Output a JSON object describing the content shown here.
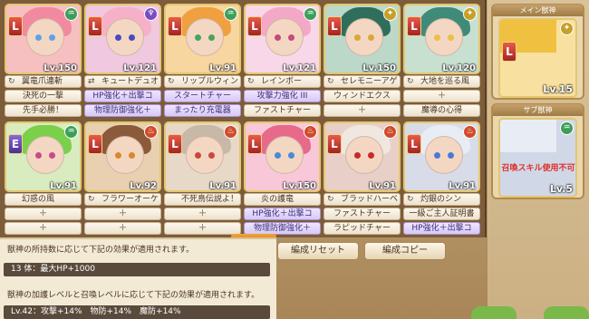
{
  "cards": [
    {
      "rank": "L",
      "elem": "♒",
      "elem_color": "#3d9e5a",
      "level": "Lv.150",
      "name": "翼竜爪連斬",
      "name_icon": "↻",
      "skill1": "決死の一撃",
      "skill1_type": "normal",
      "skill2": "先手必勝！",
      "skill2_type": "normal",
      "palette": {
        "bg": "#f6c0c0",
        "hair": "#f18aa0",
        "eye": "#5ea2e6"
      }
    },
    {
      "rank": "L",
      "elem": "♆",
      "elem_color": "#7a4cc4",
      "level": "Lv.121",
      "name": "キュートデュオ",
      "name_icon": "⇄",
      "skill1": "HP強化＋出撃コ",
      "skill1_type": "purple",
      "skill2": "物理防御強化＋",
      "skill2_type": "purple",
      "palette": {
        "bg": "#f0c8e0",
        "hair": "#f6b0c8",
        "eye": "#4a4abf"
      }
    },
    {
      "rank": "L",
      "elem": "♒",
      "elem_color": "#3d9e5a",
      "level": "Lv.91",
      "name": "リップルウィンド",
      "name_icon": "↻",
      "skill1": "スタートチャー",
      "skill1_type": "purple",
      "skill2": "まったり充電器",
      "skill2_type": "purple",
      "palette": {
        "bg": "#f7d6a0",
        "hair": "#f0a040",
        "eye": "#4aa35a"
      }
    },
    {
      "rank": "L",
      "elem": "♒",
      "elem_color": "#3d9e5a",
      "level": "Lv.121",
      "name": "レインボー",
      "name_icon": "↻",
      "skill1": "攻撃力強化 III",
      "skill1_type": "purple",
      "skill2": "ファストチャー",
      "skill2_type": "normal",
      "palette": {
        "bg": "#f8d8e8",
        "hair": "#f4a8c8",
        "eye": "#c64a7a"
      }
    },
    {
      "rank": "L",
      "elem": "✦",
      "elem_color": "#c7a02a",
      "level": "Lv.150",
      "name": "セレモニーアゲ",
      "name_icon": "↻",
      "skill1": "ウィンドエクス",
      "skill1_type": "normal",
      "skill2": "＋",
      "skill2_type": "plus",
      "palette": {
        "bg": "#bcd8c8",
        "hair": "#2f6e5a",
        "eye": "#d8a83a"
      }
    },
    {
      "rank": "L",
      "elem": "✦",
      "elem_color": "#c7a02a",
      "level": "Lv.120",
      "name": "大地を巡る風",
      "name_icon": "↻",
      "skill1": "＋",
      "skill1_type": "plus",
      "skill2": "魔導の心得",
      "skill2_type": "normal",
      "palette": {
        "bg": "#c8e0d0",
        "hair": "#3f8a78",
        "eye": "#e8c048"
      }
    },
    {
      "rank": "E",
      "elem": "♒",
      "elem_color": "#3d9e5a",
      "level": "Lv.91",
      "name": "幻惑の風",
      "name_icon": "",
      "skill1": "＋",
      "skill1_type": "plus",
      "skill2": "＋",
      "skill2_type": "plus",
      "palette": {
        "bg": "#d8ecc0",
        "hair": "#7ad04a",
        "eye": "#c84a8a"
      }
    },
    {
      "rank": "L",
      "elem": "♨",
      "elem_color": "#d04a2a",
      "level": "Lv.92",
      "name": "フラワーオーケ",
      "name_icon": "↻",
      "skill1": "＋",
      "skill1_type": "plus",
      "skill2": "＋",
      "skill2_type": "plus",
      "palette": {
        "bg": "#e8d0b0",
        "hair": "#8a5a3a",
        "eye": "#d88a2a"
      }
    },
    {
      "rank": "L",
      "elem": "♨",
      "elem_color": "#d04a2a",
      "level": "Lv.91",
      "name": "不死鳥伝説よ！",
      "name_icon": "",
      "skill1": "＋",
      "skill1_type": "plus",
      "skill2": "＋",
      "skill2_type": "plus",
      "palette": {
        "bg": "#e8d8c8",
        "hair": "#c8b8a8",
        "eye": "#c84a3a"
      }
    },
    {
      "rank": "L",
      "elem": "♨",
      "elem_color": "#d04a2a",
      "level": "Lv.150",
      "name": "炎の護竜",
      "name_icon": "",
      "skill1": "HP強化＋出撃コ",
      "skill1_type": "purple",
      "skill2": "物理防御強化＋",
      "skill2_type": "purple",
      "palette": {
        "bg": "#f8c8d8",
        "hair": "#e86a8a",
        "eye": "#4a8ad8"
      }
    },
    {
      "rank": "L",
      "elem": "♨",
      "elem_color": "#d04a2a",
      "level": "Lv.91",
      "name": "ブラッドハーベ",
      "name_icon": "↻",
      "skill1": "ファストチャー",
      "skill1_type": "normal",
      "skill2": "ラピッドチャー",
      "skill2_type": "normal",
      "palette": {
        "bg": "#e8d0c8",
        "hair": "#f0e8e0",
        "eye": "#c82a2a"
      }
    },
    {
      "rank": "L",
      "elem": "♨",
      "elem_color": "#d04a2a",
      "level": "Lv.91",
      "name": "灼銀のシン",
      "name_icon": "↻",
      "skill1": "一級ご主人証明書",
      "skill1_type": "normal",
      "skill2": "HP強化＋出撃コ",
      "skill2_type": "purple",
      "palette": {
        "bg": "#d8dce8",
        "hair": "#e8ecf4",
        "eye": "#4a7ad8"
      }
    }
  ],
  "main_box": {
    "title": "メイン獣神",
    "rank": "L",
    "level": "Lv.15",
    "elem": "✦",
    "elem_color": "#c7a02a",
    "palette": {
      "bg": "#f8e0a0",
      "hair": "#f0c040",
      "eye": "#4a8ad8"
    }
  },
  "sub_box": {
    "title": "サブ獣神",
    "level": "Lv.5",
    "elem": "♒",
    "elem_color": "#3d9e5a",
    "warning": "召喚スキル使用不可",
    "palette": {
      "bg": "#d0d8e8",
      "hair": "#e8ecf4",
      "eye": "#3a6ac8"
    }
  },
  "buttons": {
    "reset": "編成リセット",
    "copy": "編成コピー"
  },
  "info": {
    "line1": "獣神の所持数に応じて下記の効果が適用されます。",
    "bar1": "13 体：最大HP+1000",
    "line2": "獣神の加護レベルと召喚レベルに応じて下記の効果が適用されます。",
    "bar2": "Lv.42：攻撃+14%　物防+14%　魔防+14%"
  }
}
